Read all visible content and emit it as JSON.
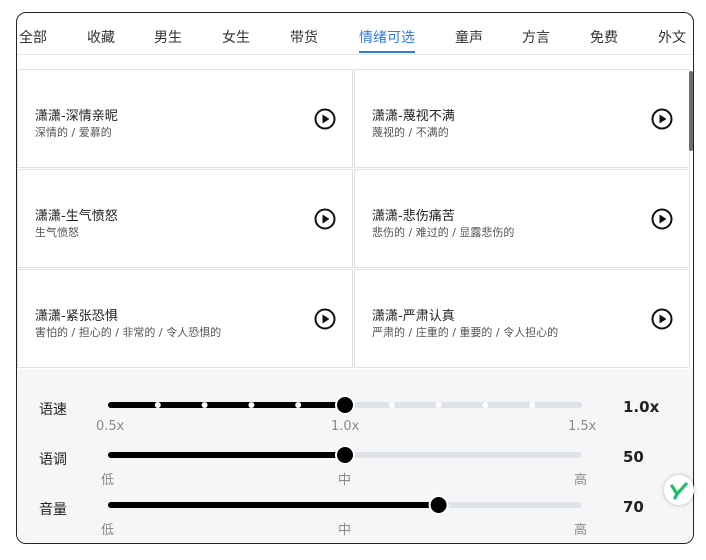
{
  "tabs": [
    {
      "label": "全部",
      "active": false
    },
    {
      "label": "收藏",
      "active": false
    },
    {
      "label": "男生",
      "active": false
    },
    {
      "label": "女生",
      "active": false
    },
    {
      "label": "带货",
      "active": false
    },
    {
      "label": "情绪可选",
      "active": true
    },
    {
      "label": "童声",
      "active": false
    },
    {
      "label": "方言",
      "active": false
    },
    {
      "label": "免费",
      "active": false
    },
    {
      "label": "外文",
      "active": false
    }
  ],
  "cards": [
    {
      "title": "潇潇-深情亲昵",
      "tags": "深情的 / 爱慕的"
    },
    {
      "title": "潇潇-蔑视不满",
      "tags": "蔑视的 / 不满的"
    },
    {
      "title": "潇潇-生气愤怒",
      "tags": "生气愤怒"
    },
    {
      "title": "潇潇-悲伤痛苦",
      "tags": "悲伤的 / 难过的 / 显露悲伤的"
    },
    {
      "title": "潇潇-紧张恐惧",
      "tags": "害怕的 / 担心的 / 非常的 / 令人恐惧的"
    },
    {
      "title": "潇潇-严肃认真",
      "tags": "严肃的 / 庄重的 / 重要的 / 令人担心的"
    }
  ],
  "controls": {
    "speed": {
      "label": "语速",
      "value": "1.0x",
      "level": 0.5,
      "ticks": [
        "0.5x",
        "1.0x",
        "1.5x"
      ]
    },
    "pitch": {
      "label": "语调",
      "value": "50",
      "level": 0.5,
      "ticks": [
        "低",
        "中",
        "高"
      ]
    },
    "volume": {
      "label": "音量",
      "value": "70",
      "level": 0.7,
      "ticks": [
        "低",
        "中",
        "高"
      ]
    }
  },
  "colors": {
    "accent": "#2f7be8",
    "badge": "#1fbf6a"
  },
  "icons": {
    "play": "play-circle-icon",
    "badge": "check-badge-icon"
  }
}
